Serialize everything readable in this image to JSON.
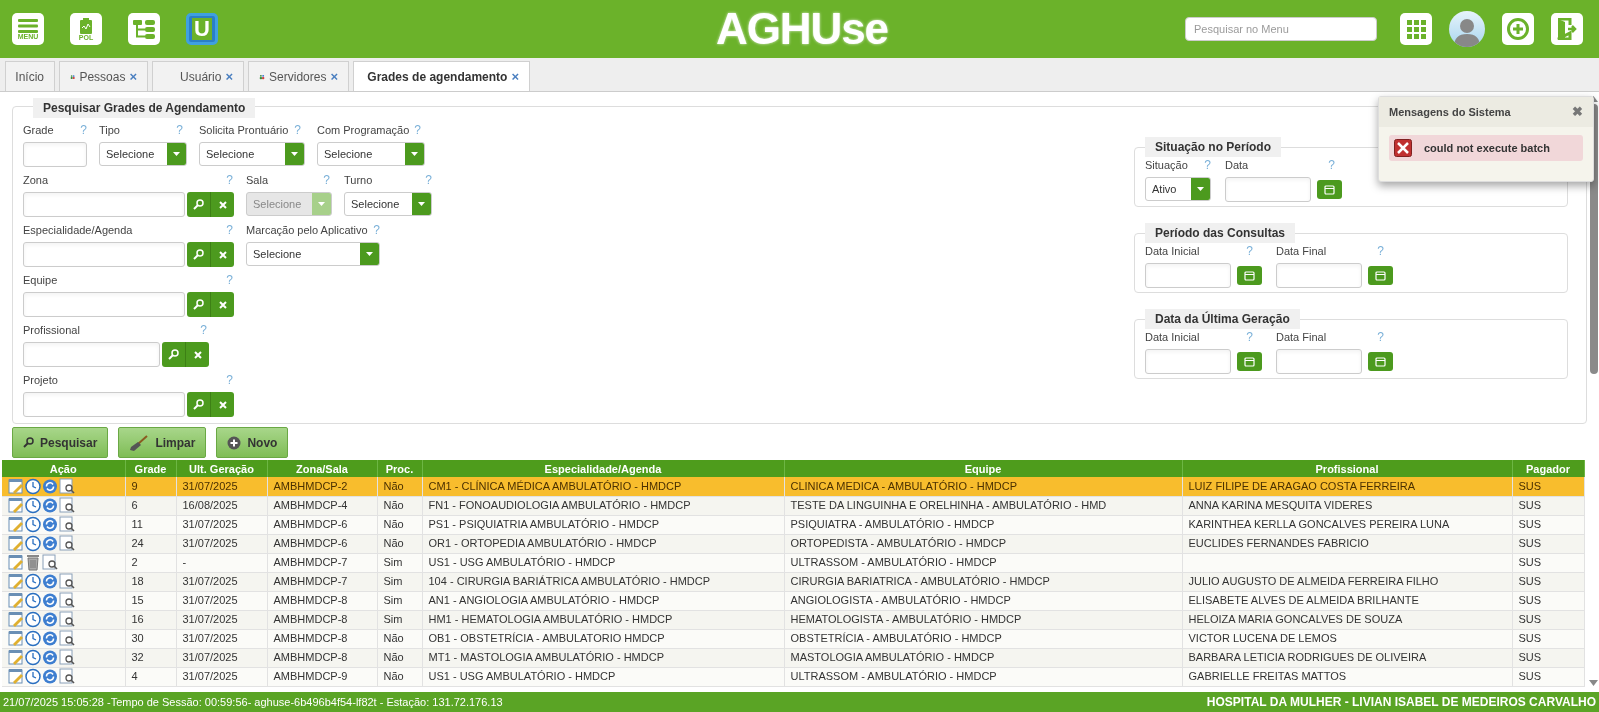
{
  "header": {
    "buttons": [
      {
        "kind": "menu",
        "label": "MENU"
      },
      {
        "kind": "pol",
        "label": "POL"
      },
      {
        "kind": "tree"
      },
      {
        "kind": "u-logo",
        "label": "U"
      }
    ],
    "logo": "AGHUse",
    "search": {
      "placeholder": "Pesquisar no Menu"
    },
    "right_buttons": [
      {
        "kind": "grid"
      },
      {
        "kind": "avatar"
      },
      {
        "kind": "cycle-plus"
      },
      {
        "kind": "exit"
      }
    ]
  },
  "tabs": [
    {
      "label": "Início",
      "icon": false,
      "closable": false,
      "selected": false
    },
    {
      "label": "Pessoas",
      "icon": true,
      "closable": true,
      "selected": false
    },
    {
      "label": "Usuário",
      "icon": false,
      "closable": true,
      "selected": false
    },
    {
      "label": "Servidores",
      "icon": true,
      "closable": true,
      "selected": false
    },
    {
      "label": "Grades de agendamento",
      "icon": false,
      "closable": true,
      "selected": true
    }
  ],
  "tab_close": "×",
  "search_form": {
    "title": "Pesquisar Grades de Agendamento",
    "help": "?",
    "fields": [
      {
        "kind": "text",
        "label": "Grade"
      },
      {
        "kind": "select",
        "label": "Tipo",
        "value": "Selecione",
        "disabled": false
      },
      {
        "kind": "select",
        "label": "Solicita Prontuário",
        "value": "Selecione",
        "disabled": false
      },
      {
        "kind": "select",
        "label": "Com Programação",
        "value": "Selecione",
        "disabled": false
      },
      {
        "kind": "lookup",
        "label": "Zona"
      },
      {
        "kind": "select",
        "label": "Sala",
        "value": "Selecione",
        "disabled": true
      },
      {
        "kind": "select",
        "label": "Turno",
        "value": "Selecione",
        "disabled": false
      },
      {
        "kind": "lookup",
        "label": "Especialidade/Agenda"
      },
      {
        "kind": "select",
        "label": "Marcação pelo Aplicativo",
        "value": "Selecione",
        "disabled": false
      },
      {
        "kind": "lookup",
        "label": "Equipe"
      },
      {
        "kind": "lookup",
        "label": "Profissional"
      },
      {
        "kind": "lookup",
        "label": "Projeto"
      }
    ],
    "fieldsets": [
      {
        "title": "Situação no Período",
        "fields": [
          {
            "kind": "select",
            "label": "Situação",
            "value": "Ativo",
            "disabled": false
          },
          {
            "kind": "date",
            "label": "Data"
          }
        ]
      },
      {
        "title": "Período das Consultas",
        "fields": [
          {
            "kind": "date",
            "label": "Data Inicial"
          },
          {
            "kind": "date",
            "label": "Data Final"
          }
        ]
      },
      {
        "title": "Data da Última Geração",
        "fields": [
          {
            "kind": "date",
            "label": "Data Inicial"
          },
          {
            "kind": "date",
            "label": "Data Final"
          }
        ]
      }
    ]
  },
  "actions": [
    {
      "kind": "search",
      "label": "Pesquisar"
    },
    {
      "kind": "clear",
      "label": "Limpar"
    },
    {
      "kind": "new",
      "label": "Novo"
    }
  ],
  "messages": {
    "title": "Mensagens do Sistema",
    "close": "✖",
    "items": [
      {
        "kind": "error",
        "text": "could not execute batch"
      }
    ]
  },
  "table": {
    "action_column": "Ação",
    "columns": [
      "Grade",
      "Ult. Geração",
      "Zona/Sala",
      "Proc.",
      "Especialidade/Agenda",
      "Equipe",
      "Profissional",
      "Pagador"
    ],
    "rows": [
      {
        "selected": true,
        "deletable": false,
        "cells": [
          "9",
          "31/07/2025",
          "AMBHMDCP-2",
          "Não",
          "CM1 - CLÍNICA MÉDICA AMBULATÓRIO - HMDCP",
          "CLINICA MEDICA - AMBULATÓRIO - HMDCP",
          "LUIZ FILIPE DE ARAGAO COSTA FERREIRA",
          "SUS"
        ]
      },
      {
        "selected": false,
        "deletable": false,
        "cells": [
          "6",
          "16/08/2025",
          "AMBHMDCP-4",
          "Não",
          "FN1 - FONOAUDIOLOGIA AMBULATÓRIO - HMDCP",
          "TESTE DA LINGUINHA E ORELHINHA - AMBULATÓRIO - HMD",
          "ANNA KARINA MESQUITA VIDERES",
          "SUS"
        ]
      },
      {
        "selected": false,
        "deletable": false,
        "cells": [
          "11",
          "31/07/2025",
          "AMBHMDCP-6",
          "Não",
          "PS1 - PSIQUIATRIA AMBULATÓRIO - HMDCP",
          "PSIQUIATRA - AMBULATÓRIO - HMDCP",
          "KARINTHEA KERLLA GONCALVES PEREIRA LUNA",
          "SUS"
        ]
      },
      {
        "selected": false,
        "deletable": false,
        "cells": [
          "24",
          "31/07/2025",
          "AMBHMDCP-6",
          "Não",
          "OR1 - ORTOPEDIA AMBULATÓRIO - HMDCP",
          "ORTOPEDISTA - AMBULATÓRIO - HMDCP",
          "EUCLIDES FERNANDES FABRICIO",
          "SUS"
        ]
      },
      {
        "selected": false,
        "deletable": true,
        "cells": [
          "2",
          "-",
          "AMBHMDCP-7",
          "Sim",
          "US1 - USG AMBULATÓRIO - HMDCP",
          "ULTRASSOM - AMBULATÓRIO - HMDCP",
          "",
          "SUS"
        ]
      },
      {
        "selected": false,
        "deletable": false,
        "cells": [
          "18",
          "31/07/2025",
          "AMBHMDCP-7",
          "Sim",
          "104 - CIRURGIA BARIÁTRICA AMBULATÓRIO - HMDCP",
          "CIRURGIA BARIATRICA - AMBULATÓRIO - HMDCP",
          "JULIO AUGUSTO DE ALMEIDA FERREIRA FILHO",
          "SUS"
        ]
      },
      {
        "selected": false,
        "deletable": false,
        "cells": [
          "15",
          "31/07/2025",
          "AMBHMDCP-8",
          "Sim",
          "AN1 - ANGIOLOGIA AMBULATÓRIO - HMDCP",
          "ANGIOLOGISTA - AMBULATÓRIO - HMDCP",
          "ELISABETE ALVES DE ALMEIDA BRILHANTE",
          "SUS"
        ]
      },
      {
        "selected": false,
        "deletable": false,
        "cells": [
          "16",
          "31/07/2025",
          "AMBHMDCP-8",
          "Sim",
          "HM1 - HEMATOLOGIA AMBULATÓRIO - HMDCP",
          "HEMATOLOGISTA - AMBULATÓRIO - HMDCP",
          "HELOIZA MARIA GONCALVES DE SOUZA",
          "SUS"
        ]
      },
      {
        "selected": false,
        "deletable": false,
        "cells": [
          "30",
          "31/07/2025",
          "AMBHMDCP-8",
          "Não",
          "OB1 - OBSTETRÍCIA - AMBULATORIO HMDCP",
          "OBSTETRÍCIA - AMBULATÓRIO - HMDCP",
          "VICTOR LUCENA DE LEMOS",
          "SUS"
        ]
      },
      {
        "selected": false,
        "deletable": false,
        "cells": [
          "32",
          "31/07/2025",
          "AMBHMDCP-8",
          "Não",
          "MT1 - MASTOLOGIA AMBULATÓRIO - HMDCP",
          "MASTOLOGIA AMBULATÓRIO - HMDCP",
          "BARBARA LETICIA RODRIGUES DE OLIVEIRA",
          "SUS"
        ]
      },
      {
        "selected": false,
        "deletable": false,
        "cells": [
          "4",
          "31/07/2025",
          "AMBHMDCP-9",
          "Não",
          "US1 - USG AMBULATÓRIO - HMDCP",
          "ULTRASSOM - AMBULATÓRIO - HMDCP",
          "GABRIELLE FREITAS MATTOS",
          "SUS"
        ]
      }
    ]
  },
  "status_bar": {
    "left": "21/07/2025 15:05:28 -Tempo de Sessão: 00:59:56- aghuse-6b496b4f54-lf82t - Estação: 131.72.176.13",
    "right": "HOSPITAL DA MULHER - LIVIAN ISABEL DE MEDEIROS CARVALHO"
  }
}
